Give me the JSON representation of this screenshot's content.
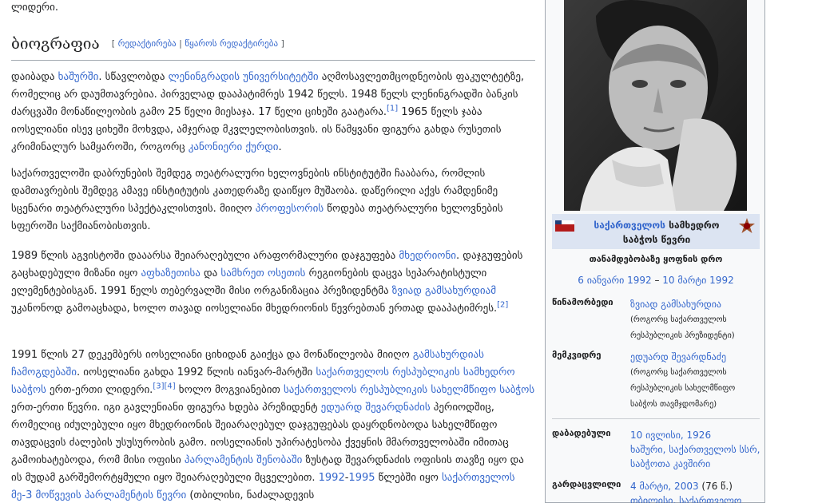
{
  "article": {
    "top_line": "ლიდერი.",
    "section_title": "ბიოგრაფია",
    "edit": {
      "open": "[",
      "edit_label": "რედაქტირება",
      "divider": "|",
      "edit_source_label": "წყაროს რედაქტირება",
      "close": "]"
    },
    "p1": {
      "t1": "დაიბადა ",
      "l1": "ხაშურში",
      "t2": ". სწავლობდა ",
      "l2": "ლენინგრადის უნივერსიტეტში",
      "t3": " აღმოსავლეთმცოდნეობის ფაკულტეტზე, რომელიც არ დაუმთავრებია. პირველად დააპატიმრეს 1942 წელს. 1948 წელს ლენინგრადში ბანკის ძარცვაში მონაწილეობის გამო 25 წელი მიესაჯა. 17 წელი ციხეში გაატარა.",
      "ref1": "[1]",
      "t4": " 1965 წელს ჯაბა იოსელიანი ისევ ციხეში მოხვდა, ამჯერად მკვლელობისთვის. ის წამყვანი ფიგურა გახდა რუსეთის კრიმინალურ სამყაროში, როგორც ",
      "l3": "კანონიერი ქურდი",
      "t5": "."
    },
    "p2": {
      "t1": "საქართველოში დაბრუნების შემდეგ თეატრალური ხელოვნების ინსტიტუტში ჩააბარა, რომლის დამთავრების შემდეგ ამავე ინსტიტუტის კათედრაზე დაიწყო მუშაობა. დაწერილი აქვს რამდენიმე სცენარი თეატრალური სპექტაკლისთვის. მიიღო ",
      "l1": "პროფესორის",
      "t2": " წოდება თეატრალური ხელოვნების სფეროში საქმიანობისთვის."
    },
    "p3": {
      "t1": "1989 წლის აგვისტოში დააარსა შეიარაღებული არაფორმალური დაჯგუფება ",
      "l1": "მხედრიონი",
      "t2": ". დაჯგუფების გაცხადებული მიზანი იყო ",
      "l2": "აფხაზეთისა",
      "t3": " და ",
      "l3": "სამხრეთ ოსეთის",
      "t4": " რეგიონების დაცვა სეპარატისტული ელემენტებისგან. 1991 წელს თებერვალში მისი ორგანიზაცია პრეზიდენტმა ",
      "l4": "ზვიად გამსახურდიამ",
      "t5": " უკანონოდ გამოაცხადა, ხოლო თავად იოსელიანი მხედრიონის წევრებთან ერთად დააპატიმრეს.",
      "ref2": "[2]"
    },
    "p4": {
      "t1": "1991 წლის 27 დეკემბერს იოსელიანი ციხიდან გაიქცა და მონაწილეობა მიიღო ",
      "l1": "გამსახურდიას ჩამოგდებაში",
      "t2": ". იოსელიანი გახდა 1992 წლის იანვარ-მარტში ",
      "l2": "საქართველოს რესპუბლიკის სამხედრო საბჭოს",
      "t3": " ერთ-ერთი ლიდერი.",
      "ref3": "[3]",
      "ref4": "[4]",
      "t4": " ხოლო მოგვიანებით ",
      "l3": "საქართველოს რესპუბლიკის სახელმწიფო საბჭოს",
      "t5": " ერთ-ერთი წევრი. იგი გავლენიანი ფიგურა ხდება პრეზიდენტ ",
      "l4": "ედუარდ შევარდნაძის",
      "t6": " პერიოდშიც, რომელიც იძულებული იყო მხედრიონის შეიარაღებულ დაჯგუფებას დაყრდნობოდა სახელმწიფო თავდაცვის ძალების უსუსურობის გამო. იოსელიანის უპირატესობა ქვეყნის მმართველობაში იმითაც გამოიხატებოდა, რომ მისი ოფისი ",
      "l5": "პარლამენტის შენობაში",
      "t7": " ზუსტად შევარდნაძის ოფისის თავზე იყო და ის მუდამ გარშემორტყმული იყო შეიარაღებული მცველებით. ",
      "l6": "1992",
      "t8": "-",
      "l7": "1995",
      "t9": " წლებში იყო ",
      "l8": "საქართველოს მე-3 მოწვევის პარლამენტის წევრი",
      "t10": " (თბილისი, ნაძალადევის"
    }
  },
  "infobox": {
    "photo_icon": "portrait-photo",
    "office_link": "საქართველოს",
    "office_rest": " სამხედრო საბჭოს წევრი",
    "term_label": "თანამდებობაზე ყოფნის დრო",
    "term_start": "6 იანვარი 1992",
    "term_dash": " – ",
    "term_end": "10 მარტი 1992",
    "predecessor_label": "წინამორბედი",
    "predecessor_link": "ზვიად გამსახურდია",
    "predecessor_note": "(როგორც საქართველოს რესპუბლიკის პრეზიდენტი)",
    "successor_label": "მემკვიდრე",
    "successor_link": "ედუარდ შევარდნაძე",
    "successor_note": "(როგორც საქართველოს რესპუბლიკის სახელმწიფო საბჭოს თავმჯდომარე)",
    "born_label": "დაბადებული",
    "born_date_link": "10 ივლისი, 1926",
    "born_place_link": "ხაშური, საქართველოს სსრ, საბჭოთა კავშირი",
    "died_label": "გარდაცვლილი",
    "died_date_link": "4 მარტი, 2003",
    "died_age": " (76 წ.)",
    "died_place_link": "თბილისი, საქართველო"
  },
  "colors": {
    "link": "#3366cc",
    "text": "#202122",
    "infobox_bg": "#f8f9fa",
    "office_bg": "#dce4f2"
  }
}
